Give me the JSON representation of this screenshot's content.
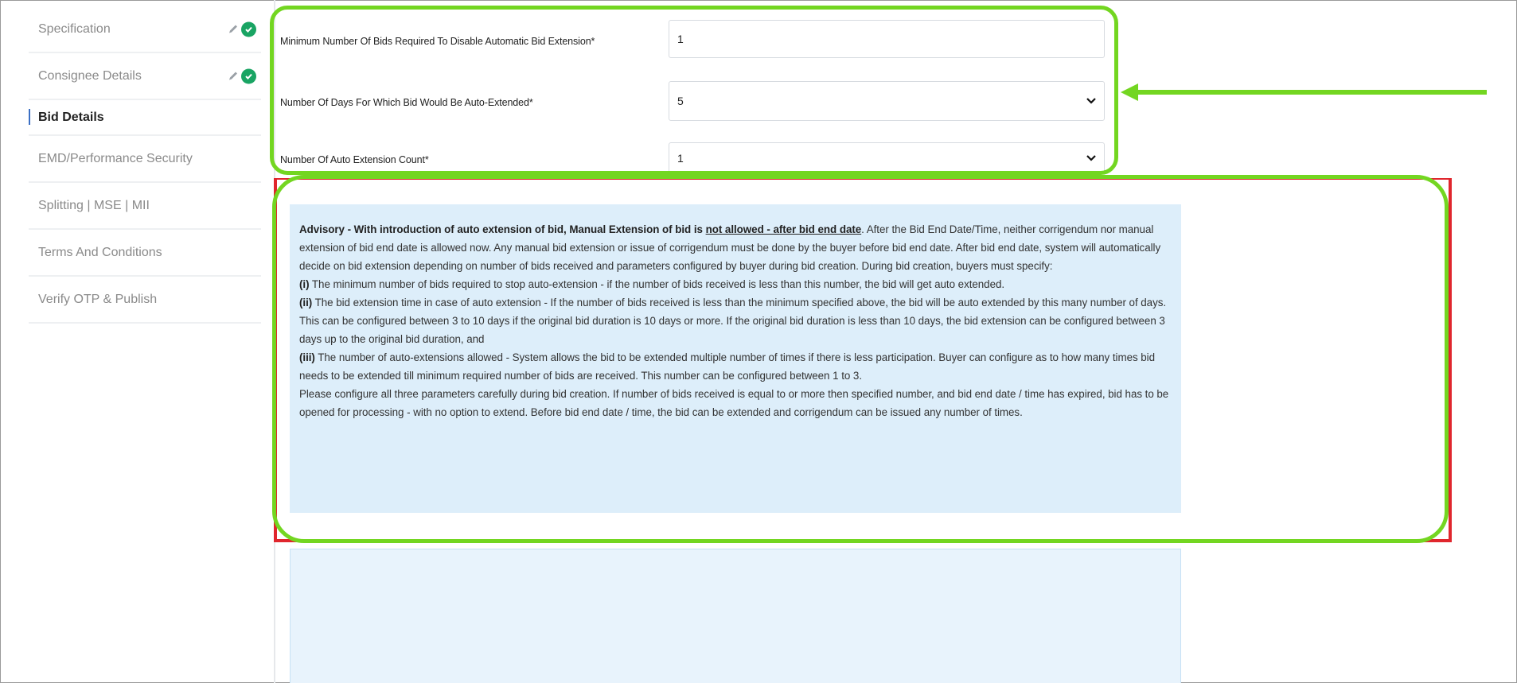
{
  "sidebar": {
    "items": [
      {
        "label": "Specification",
        "completed": true
      },
      {
        "label": "Consignee Details",
        "completed": true
      },
      {
        "label": "Bid Details",
        "active": true
      },
      {
        "label": "EMD/Performance Security"
      },
      {
        "label": "Splitting | MSE | MII"
      },
      {
        "label": "Terms And Conditions"
      },
      {
        "label": "Verify OTP & Publish"
      }
    ]
  },
  "form": {
    "min_bids": {
      "label": "Minimum Number Of Bids Required To Disable Automatic Bid Extension*",
      "value": "1"
    },
    "auto_extend_days": {
      "label": "Number Of Days For Which Bid Would Be Auto-Extended*",
      "value": "5"
    },
    "auto_extension_count": {
      "label": "Number Of Auto Extension Count*",
      "value": "1"
    }
  },
  "advisory": {
    "lead_bold": "Advisory - With introduction of auto extension of bid, Manual Extension of bid is",
    "lead_underline": "not allowed - after bid end date",
    "lead_rest": ". After the Bid End Date/Time, neither corrigendum nor manual extension of bid end date is allowed now. Any manual bid extension or issue of corrigendum must be done by the buyer before bid end date. After bid end date, system will automatically decide on bid extension depending on number of bids received and parameters configured by buyer during bid creation. During bid creation, buyers must specify:",
    "item1_marker": "(i)",
    "item1_text": " The minimum number of bids required to stop auto-extension - if the number of bids received is less than this number, the bid will get auto extended.",
    "item2_marker": "(ii)",
    "item2_text": " The bid extension time in case of auto extension - If the number of bids received is less than the minimum specified above, the bid will be auto extended by this many number of days. This can be configured between 3 to 10 days if the original bid duration is 10 days or more. If the original bid duration is less than 10 days, the bid extension can be configured between 3 days up to the original bid duration, and",
    "item3_marker": "(iii)",
    "item3_text": " The number of auto-extensions allowed - System allows the bid to be extended multiple number of times if there is less participation. Buyer can configure as to how many times bid needs to be extended till minimum required number of bids are received. This number can be configured between 1 to 3.",
    "closing": "Please configure all three parameters carefully during bid creation. If number of bids received is equal to or more then specified number, and bid end date / time has expired, bid has to be opened for processing - with no option to extend. Before bid end date / time, the bid can be extended and corrigendum can be issued any number of times."
  },
  "colors": {
    "highlight_green": "#73d621",
    "highlight_red": "#e0262d",
    "check_green": "#19a463",
    "advisory_bg": "#ddeefa",
    "active_marker": "#3b6fc4"
  },
  "icons": [
    "pencil-icon",
    "check-circle-icon",
    "chevron-down-icon",
    "arrow-left-icon"
  ]
}
